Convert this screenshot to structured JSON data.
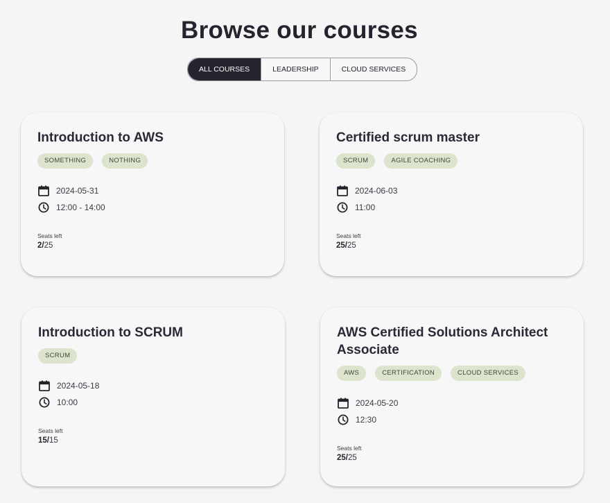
{
  "page": {
    "title": "Browse our courses"
  },
  "filters": [
    {
      "label": "ALL COURSES",
      "active": true
    },
    {
      "label": "LEADERSHIP",
      "active": false
    },
    {
      "label": "CLOUD SERVICES",
      "active": false
    }
  ],
  "courses": [
    {
      "title": "Introduction to AWS",
      "tags": [
        "SOMETHING",
        "NOTHING"
      ],
      "date": "2024-05-31",
      "time": "12:00 - 14:00",
      "seats_label": "Seats left",
      "seats_left": "2",
      "seats_total": "25"
    },
    {
      "title": "Certified scrum master",
      "tags": [
        "SCRUM",
        "AGILE COACHING"
      ],
      "date": "2024-06-03",
      "time": "11:00",
      "seats_label": "Seats left",
      "seats_left": "25",
      "seats_total": "25"
    },
    {
      "title": "Introduction to SCRUM",
      "tags": [
        "SCRUM"
      ],
      "date": "2024-05-18",
      "time": "10:00",
      "seats_label": "Seats left",
      "seats_left": "15",
      "seats_total": "15"
    },
    {
      "title": "AWS Certified Solutions Architect Associate",
      "tags": [
        "AWS",
        "CERTIFICATION",
        "CLOUD SERVICES"
      ],
      "date": "2024-05-20",
      "time": "12:30",
      "seats_label": "Seats left",
      "seats_left": "25",
      "seats_total": "25"
    }
  ],
  "icons": {
    "date": "calendar-icon",
    "time": "clock-icon"
  },
  "colors": {
    "primary": "#24242e",
    "tag_bg": "#dde4cd",
    "background": "#f5f5f5"
  }
}
